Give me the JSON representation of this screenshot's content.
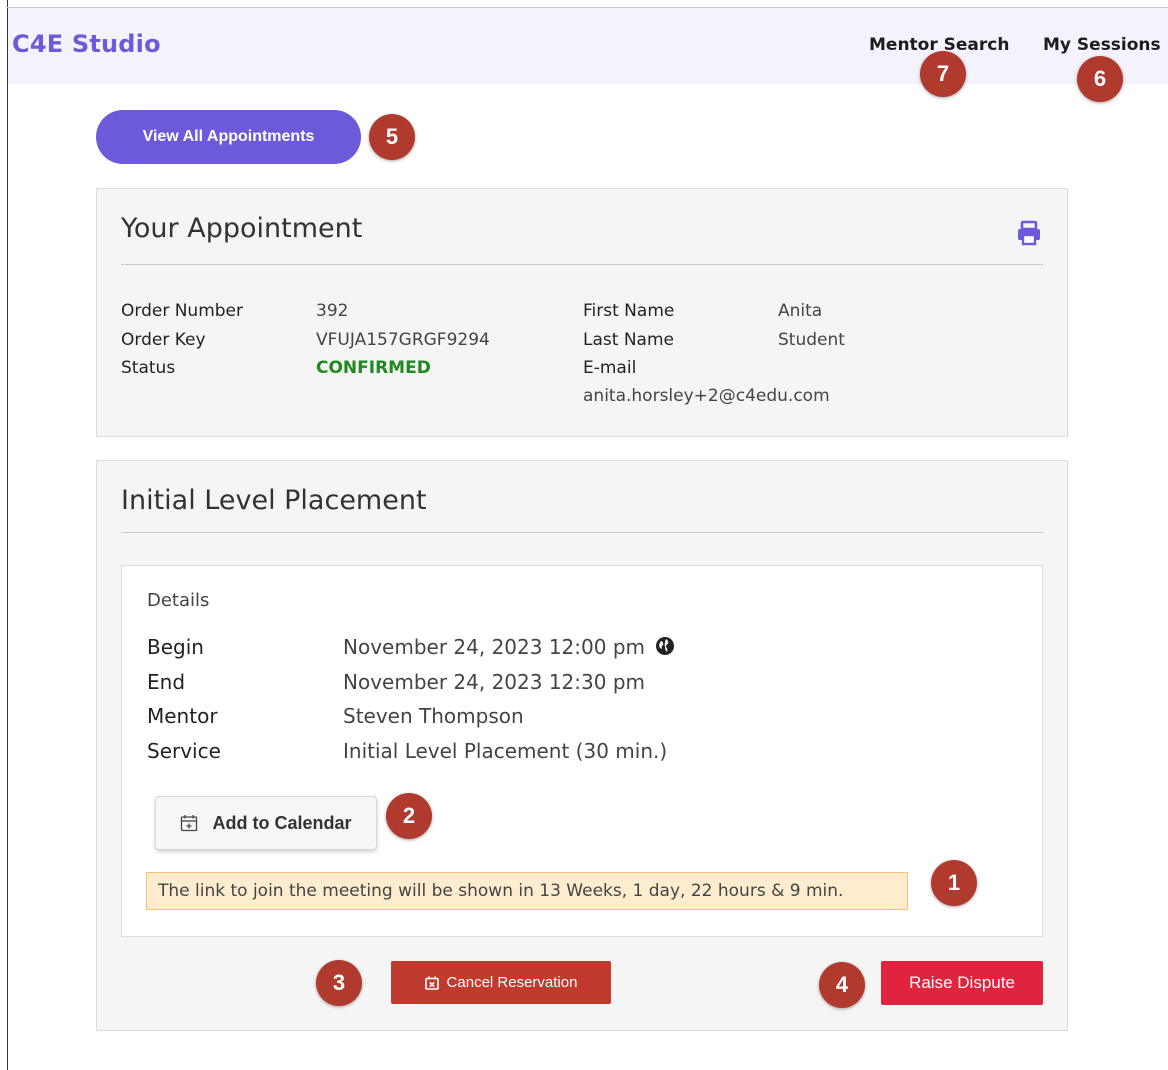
{
  "navbar": {
    "brand": "C4E Studio",
    "links": [
      "Mentor Search",
      "My Sessions"
    ]
  },
  "actions": {
    "view_all_label": "View All Appointments"
  },
  "appointment": {
    "title": "Your Appointment",
    "left_fields": [
      {
        "label": "Order Number",
        "value": "392"
      },
      {
        "label": "Order Key",
        "value": "VFUJA157GRGF9294"
      },
      {
        "label": "Status",
        "value": "CONFIRMED"
      }
    ],
    "right_fields": [
      {
        "label": "First Name",
        "value": "Anita"
      },
      {
        "label": "Last Name",
        "value": "Student"
      },
      {
        "label": "E-mail",
        "value": "anita.horsley+2@c4edu.com"
      }
    ],
    "icon": "print-icon"
  },
  "placement": {
    "title": "Initial Level Placement",
    "details_heading": "Details",
    "rows": [
      {
        "label": "Begin",
        "value": "November 24, 2023 12:00 pm"
      },
      {
        "label": "End",
        "value": "November 24, 2023 12:30 pm"
      },
      {
        "label": "Mentor",
        "value": "Steven Thompson"
      },
      {
        "label": "Service",
        "value": "Initial Level Placement (30 min.)"
      }
    ],
    "add_calendar_label": "Add to Calendar",
    "notice": "The link to join the meeting will be shown in 13 Weeks, 1 day, 22 hours & 9 min.",
    "cancel_label": "Cancel Reservation",
    "dispute_label": "Raise Dispute"
  },
  "markers": [
    "1",
    "2",
    "3",
    "4",
    "5",
    "6",
    "7"
  ],
  "colors": {
    "brand": "#6b5bdb",
    "navbar_bg": "#f4f3fd",
    "confirmed": "#1f8a1f",
    "cancel_bg": "#c03a2e",
    "dispute_bg": "#e0243f",
    "notice_bg": "#fdeccd",
    "marker_bg": "#b03a2e"
  }
}
